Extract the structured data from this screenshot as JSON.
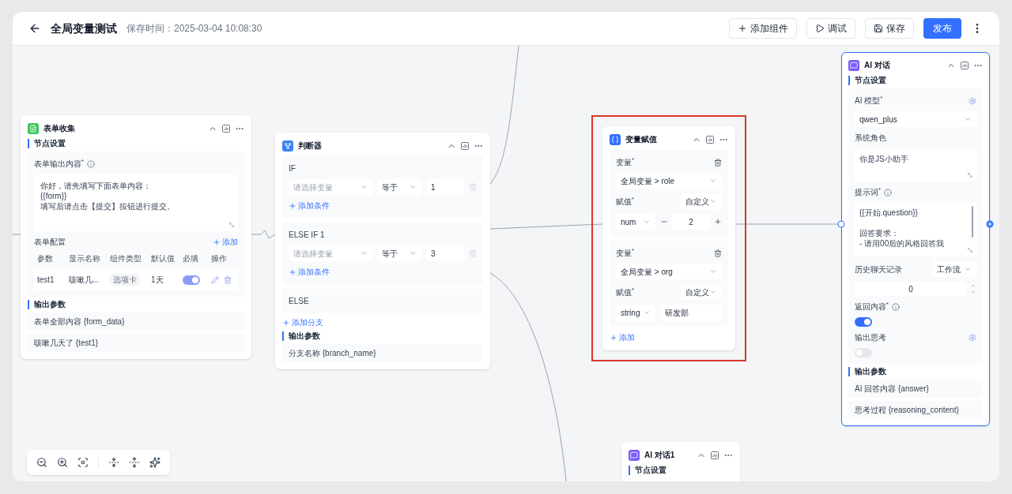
{
  "header": {
    "title": "全局变量测试",
    "saved": "保存时间：2025-03-04 10:08:30",
    "buttons": [
      {
        "kind": "add",
        "label": "添加组件"
      },
      {
        "kind": "debug",
        "label": "调试"
      },
      {
        "kind": "save",
        "label": "保存"
      },
      {
        "kind": "primary",
        "label": "发布"
      }
    ]
  },
  "nodes": [
    {
      "kind": "form",
      "title": "表单收集",
      "selected": false,
      "section": "节点设置",
      "output_label": "表单输出内容$^{*}$",
      "content": [
        "你好，请先填写下面表单内容：",
        "{{form}}",
        "填写后请点击【提交】按钮进行提交。"
      ],
      "config_label": "表单配置",
      "add": "添加",
      "columns": [
        "参数",
        "显示名称",
        "组件类型",
        "默认值",
        "必填",
        "操作"
      ],
      "rows": [
        {
          "param": "test1",
          "display": "咳嗽几...",
          "type": "选项卡",
          "default": "1天",
          "required": true
        }
      ],
      "output_title": "输出参数",
      "outputs": [
        "表单全部内容 {form_data}",
        "咳嗽几天了 {test1}"
      ]
    },
    {
      "kind": "condition",
      "title": "判断器",
      "selected": false,
      "branches": [
        {
          "label": "IF",
          "conditions": [
            {
              "variable_placeholder": "请选择变量",
              "operator": "等于",
              "value": "1"
            }
          ],
          "add": "添加条件"
        },
        {
          "label": "ELSE IF 1",
          "conditions": [
            {
              "variable_placeholder": "请选择变量",
              "operator": "等于",
              "value": "3"
            }
          ],
          "add": "添加条件"
        },
        {
          "label": "ELSE"
        }
      ],
      "add_branch": "添加分支",
      "output_title": "输出参数",
      "outputs": [
        "分支名称 {branch_name}"
      ]
    },
    {
      "kind": "variable",
      "title": "变量赋值",
      "selected": false,
      "highlighted": true,
      "items": [
        {
          "kind": "number",
          "label": "变量$^{*}$",
          "variable": "全局变量 > role",
          "value_label": "赋值$^{*}$",
          "source": "自定义",
          "type": "num",
          "value": "2"
        },
        {
          "kind": "text",
          "label": "变量$^{*}$",
          "variable": "全局变量 > org",
          "value_label": "赋值$^{*}$",
          "source": "自定义",
          "type": "string",
          "value": "研发部"
        }
      ],
      "add": "添加"
    },
    {
      "kind": "ai",
      "title": "AI 对话",
      "selected": true,
      "section": "节点设置",
      "model_label": "AI 模型$^{*}$",
      "model": "qwen_plus",
      "role_label": "系统角色",
      "role": "你是JS小助手",
      "prompt_label": "提示词$^{*}$",
      "prompt": [
        "{{开始.question}}",
        "回答要求：\n- 请用00后的风格回答我"
      ],
      "history_label": "历史聊天记录",
      "history_source": "工作流",
      "history_count": "0",
      "return_label": "返回内容$^{*}$",
      "return_on": true,
      "think_label": "输出思考",
      "think_on": false,
      "output_title": "输出参数",
      "outputs": [
        "AI 回答内容 {answer}",
        "思考过程 {reasoning_content}"
      ]
    },
    {
      "kind": "ai_partial",
      "title": "AI 对话1",
      "selected": false,
      "section": "节点设置"
    }
  ]
}
